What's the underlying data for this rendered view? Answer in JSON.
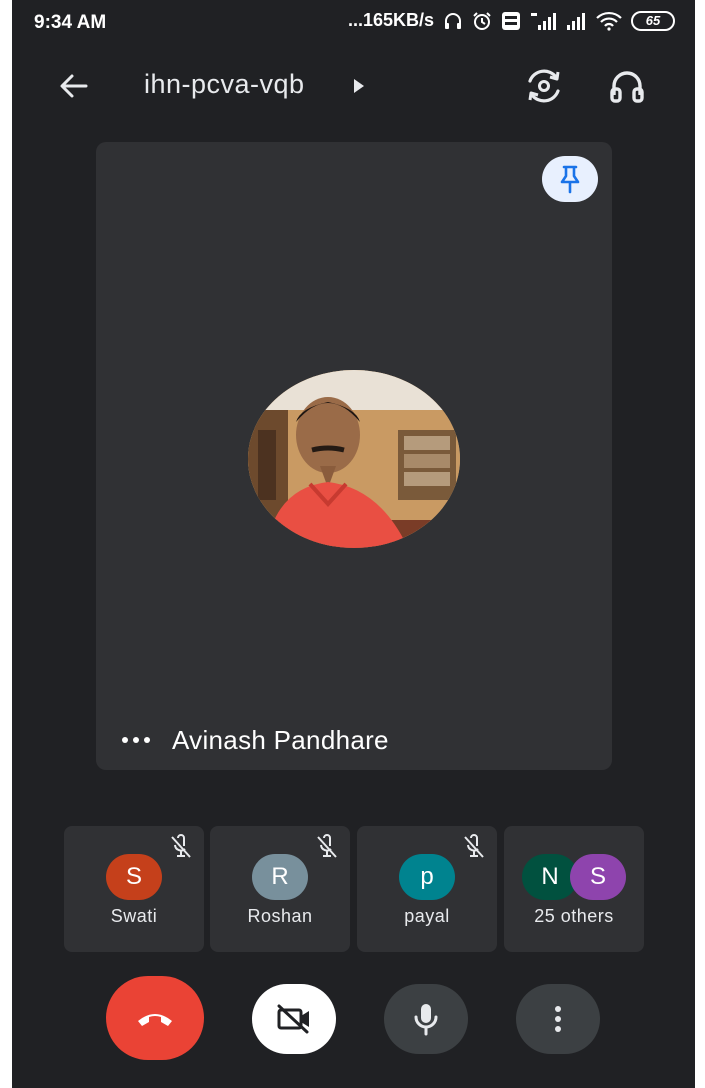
{
  "status_bar": {
    "time": "9:34 AM",
    "network_speed": "...165KB/s",
    "battery": "65"
  },
  "header": {
    "meeting_code": "ihn-pcva-vqb"
  },
  "main_tile": {
    "speaker_name": "Avinash Pandhare"
  },
  "participants": [
    {
      "initial": "S",
      "name": "Swati",
      "color": "#c5401b",
      "muted": true
    },
    {
      "initial": "R",
      "name": "Roshan",
      "color": "#78909c",
      "muted": true
    },
    {
      "initial": "p",
      "name": "payal",
      "color": "#00838f",
      "muted": true
    },
    {
      "initials": [
        "N",
        "S"
      ],
      "name": "25 others",
      "colors": [
        "#01513f",
        "#8e44ad"
      ]
    }
  ],
  "colors": {
    "background": "#202124",
    "tile": "#303134",
    "end_call": "#ea4335",
    "pin_accent": "#1a73e8"
  },
  "icons": {
    "back": "arrow-left-icon",
    "switch_camera": "switch-camera-icon",
    "audio": "headphones-icon",
    "pin": "pin-icon",
    "mute": "mic-off-icon",
    "end_call": "phone-hangup-icon",
    "camera": "video-off-icon",
    "mic": "mic-icon",
    "more": "more-vertical-icon"
  }
}
